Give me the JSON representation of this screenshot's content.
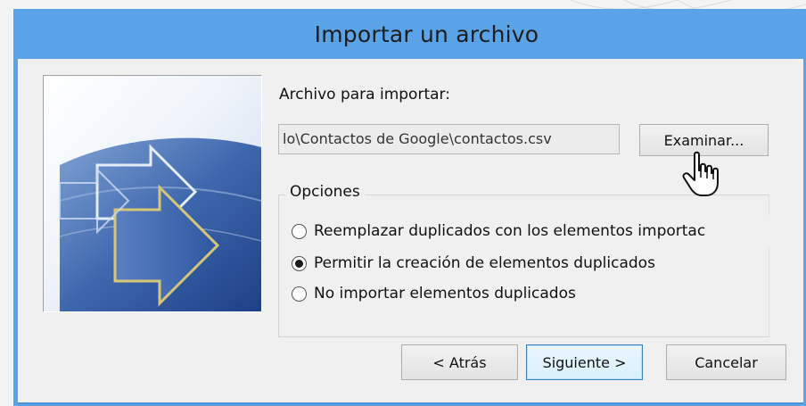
{
  "window": {
    "title": "Importar un archivo"
  },
  "file_section": {
    "label": "Archivo para importar:",
    "path_value": "lo\\Contactos de Google\\contactos.csv",
    "browse_label": "Examinar..."
  },
  "options": {
    "legend": "Opciones",
    "items": [
      {
        "label": "Reemplazar duplicados con los elementos importac",
        "checked": false
      },
      {
        "label": "Permitir la creación de elementos duplicados",
        "checked": true
      },
      {
        "label": "No importar elementos duplicados",
        "checked": false
      }
    ]
  },
  "footer": {
    "back_label": "< Atrás",
    "next_label": "Siguiente >",
    "cancel_label": "Cancelar"
  },
  "icons": {
    "wizard_image": "import-arrows-illustration",
    "cursor": "hand-pointer-icon"
  },
  "colors": {
    "titlebar": "#5aa3e6",
    "client_bg": "#f0f0f0",
    "default_button_border": "#3c7fb1"
  }
}
